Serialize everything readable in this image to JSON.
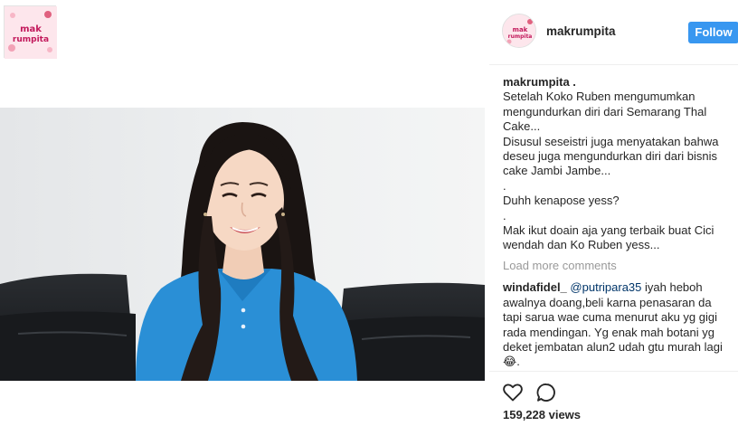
{
  "account": {
    "username": "makrumpita",
    "logo_text_top": "mak",
    "logo_text_bottom": "rumpita"
  },
  "header": {
    "follow_label": "Follow"
  },
  "caption": {
    "username": "makrumpita .",
    "lines": [
      "Setelah Koko Ruben mengumumkan",
      "mengundurkan diri dari Semarang Thal",
      "Cake...",
      "Disusul seseistri juga menyatakan bahwa",
      "deseu juga mengundurkan diri dari bisnis",
      "cake Jambi Jambe...",
      ".",
      "Duhh kenapose yess?",
      ".",
      "Mak ikut doain aja yang terbaik buat Cici",
      "wendah dan Ko Ruben yess..."
    ]
  },
  "load_more": "Load more comments",
  "comment": {
    "username": "windafidel_",
    "mention": "@putripara35",
    "first_line_rest": " iyah heboh",
    "lines": [
      "awalnya doang,beli karna penasaran da",
      "tapi sarua wae cuma menurut aku yg gigi",
      "rada mendingan. Yg enak mah botani yg",
      "deket jembatan alun2 udah gtu murah lagi",
      "😂."
    ]
  },
  "views": "159,228 views",
  "colors": {
    "follow_button": "#3897f0",
    "muted_text": "#999999",
    "mention": "#003569",
    "video_shirt": "#2a8fd6",
    "sofa": "#1b1e22"
  },
  "icons": [
    "heart-icon",
    "comment-icon",
    "play-video"
  ]
}
